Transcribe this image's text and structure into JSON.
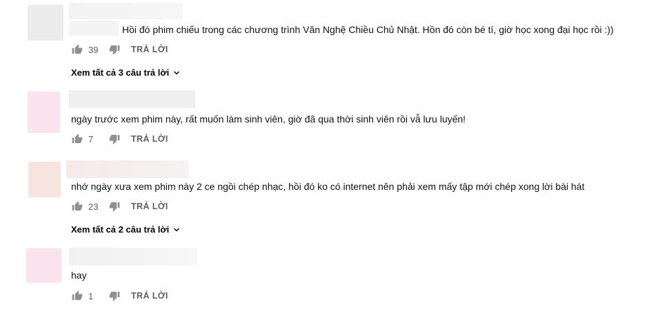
{
  "reply_label": "TRẢ LỜI",
  "comments": [
    {
      "text": "Hồi đó phim chiếu trong các chương trình Văn Nghệ Chiều Chủ Nhật. Hồn đó còn bé tí, giờ học xong đại học rồi :))",
      "likes": "39",
      "view_replies": "Xem tất cả 3 câu trả lời",
      "avatar_color": "#ececec",
      "name_color": "#f1f1f1"
    },
    {
      "text": "ngày trước xem phim này, rất muốn làm sinh viên, giờ đã qua thời sinh viên rồi vẫ lưu luyến!",
      "likes": "7",
      "view_replies": "",
      "avatar_color": "#e9e9e9",
      "name_color": "#efefef"
    },
    {
      "text": "nhớ ngày xưa xem phim này 2 ce ngồi chép nhạc, hồi đó ko có internet nên phải xem mấy tập mới chép xong lời bài hát",
      "likes": "23",
      "view_replies": "Xem tất cả 2 câu trả lời",
      "avatar_color": "#f7e6e2",
      "name_color": "#f8eded"
    },
    {
      "text": "hay",
      "likes": "1",
      "view_replies": "",
      "avatar_color": "#fbe4ef",
      "name_color": "#f4f4f4"
    }
  ]
}
